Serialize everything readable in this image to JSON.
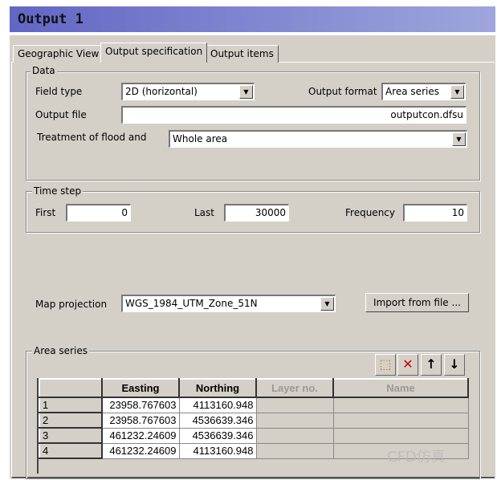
{
  "title": "Output 1",
  "tabs": [
    "Geographic View",
    "Output specification",
    "Output items"
  ],
  "data_group": {
    "label": "Data",
    "field_type_label": "Field type",
    "field_type": "2D (horizontal)",
    "output_format_label": "Output format",
    "output_format": "Area series",
    "output_file_label": "Output file",
    "output_file": "outputcon.dfsu",
    "treatment_label": "Treatment of flood and",
    "treatment": "Whole area"
  },
  "time_step": {
    "label": "Time step",
    "first_label": "First",
    "first": "0",
    "last_label": "Last",
    "last": "30000",
    "frequency_label": "Frequency",
    "frequency": "10"
  },
  "map": {
    "label": "Map projection",
    "value": "WGS_1984_UTM_Zone_51N",
    "import_button": "Import from file ..."
  },
  "area_series": {
    "label": "Area series",
    "columns": [
      "",
      "Easting",
      "Northing",
      "Layer no.",
      "Name"
    ],
    "rows": [
      [
        "1",
        "23958.767603",
        "4113160.948",
        "",
        ""
      ],
      [
        "2",
        "23958.767603",
        "4536639.346",
        "",
        ""
      ],
      [
        "3",
        "461232.24609",
        "4536639.346",
        "",
        ""
      ],
      [
        "4",
        "461232.24609",
        "4113160.948",
        "",
        ""
      ]
    ]
  },
  "watermark": "CFD仿真"
}
